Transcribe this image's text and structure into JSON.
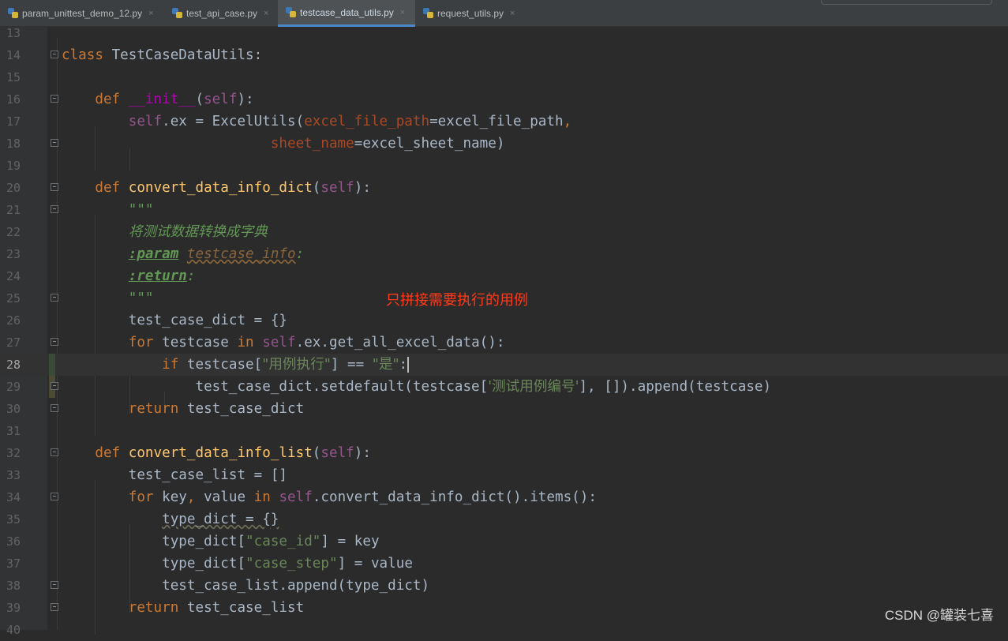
{
  "tabs": [
    {
      "label": "param_unittest_demo_12.py",
      "close": "×",
      "active": false
    },
    {
      "label": "test_api_case.py",
      "close": "×",
      "active": false
    },
    {
      "label": "testcase_data_utils.py",
      "close": "×",
      "active": true
    },
    {
      "label": "request_utils.py",
      "close": "×",
      "active": false
    }
  ],
  "editor": {
    "current_line": 28,
    "lines": [
      {
        "n": "13"
      },
      {
        "n": "14"
      },
      {
        "n": "15"
      },
      {
        "n": "16"
      },
      {
        "n": "17"
      },
      {
        "n": "18"
      },
      {
        "n": "19"
      },
      {
        "n": "20"
      },
      {
        "n": "21"
      },
      {
        "n": "22"
      },
      {
        "n": "23"
      },
      {
        "n": "24"
      },
      {
        "n": "25"
      },
      {
        "n": "26"
      },
      {
        "n": "27"
      },
      {
        "n": "28"
      },
      {
        "n": "29"
      },
      {
        "n": "30"
      },
      {
        "n": "31"
      },
      {
        "n": "32"
      },
      {
        "n": "33"
      },
      {
        "n": "34"
      },
      {
        "n": "35"
      },
      {
        "n": "36"
      },
      {
        "n": "37"
      },
      {
        "n": "38"
      },
      {
        "n": "39"
      },
      {
        "n": "40"
      }
    ],
    "code": {
      "l14": {
        "kw": "class",
        "name": "TestCaseDataUtils",
        "tail": ":"
      },
      "l16": {
        "kw": "def",
        "name": "__init__",
        "p1": "(",
        "self": "self",
        "p2": "):"
      },
      "l17": {
        "self": "self",
        "a": ".ex = ExcelUtils(",
        "kwarg": "excel_file_path",
        "b": "=excel_file_path",
        "comma": ","
      },
      "l18": {
        "kwarg": "sheet_name",
        "b": "=excel_sheet_name)"
      },
      "l20": {
        "kw": "def",
        "name": "convert_data_info_dict",
        "p1": "(",
        "self": "self",
        "p2": "):"
      },
      "l21": {
        "doc": "\"\"\""
      },
      "l22": {
        "doc": "将测试数据转换成字典"
      },
      "l23": {
        "tag": ":param",
        "ref": "testcase_info",
        "colon": ":"
      },
      "l24": {
        "tag": ":return",
        "colon": ":"
      },
      "l25": {
        "doc": "\"\"\""
      },
      "l26": {
        "text": "test_case_dict = {}"
      },
      "l27": {
        "kw": "for",
        "a": " testcase ",
        "kw2": "in",
        "self": "self",
        "b": ".ex.get_all_excel_data():"
      },
      "l28": {
        "kw": "if",
        "a": " testcase[",
        "s1": "\"用例执行\"",
        "b": "] == ",
        "s2": "\"是\"",
        "c": ":"
      },
      "l29": {
        "a": "test_case_dict.setdefault(testcase[",
        "s1": "'测试用例编号'",
        "b": "], []).append(testcase)"
      },
      "l30": {
        "kw": "return",
        "a": " test_case_dict"
      },
      "l32": {
        "kw": "def",
        "name": "convert_data_info_list",
        "p1": "(",
        "self": "self",
        "p2": "):"
      },
      "l33": {
        "text": "test_case_list = []"
      },
      "l34": {
        "kw": "for",
        "a": " key",
        "comma": ",",
        "b": " value ",
        "kw2": "in",
        "self": "self",
        "c": ".convert_data_info_dict().items():"
      },
      "l35": {
        "warn": "type_dict = {}"
      },
      "l36": {
        "a": "type_dict[",
        "s1": "\"case_id\"",
        "b": "] = key"
      },
      "l37": {
        "a": "type_dict[",
        "s1": "\"case_step\"",
        "b": "] = value"
      },
      "l38": {
        "text": "test_case_list.append(type_dict)"
      },
      "l39": {
        "kw": "return",
        "a": " test_case_list"
      }
    }
  },
  "annotation": "只拼接需要执行的用例",
  "watermark": "CSDN @罐装七喜",
  "colors": {
    "background": "#2b2b2b",
    "keyword": "#cc7832",
    "function": "#ffc66d",
    "self": "#94558d",
    "string": "#6a8759",
    "annotation": "#ff3b1a",
    "active_tab_underline": "#4a88c7"
  }
}
